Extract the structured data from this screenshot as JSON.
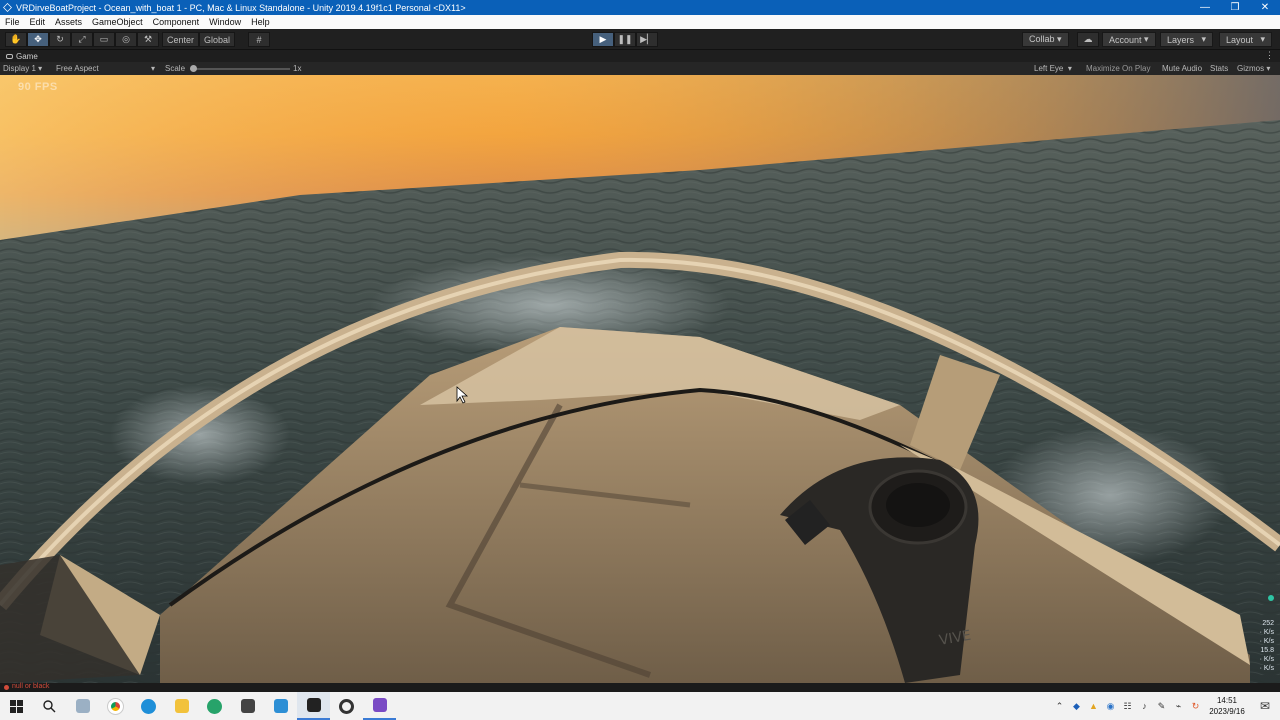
{
  "window": {
    "title": "VRDirveBoatProject - Ocean_with_boat 1 - PC, Mac & Linux Standalone - Unity 2019.4.19f1c1 Personal <DX11>",
    "controls": [
      "—",
      "❒",
      "✕"
    ]
  },
  "menu": [
    "File",
    "Edit",
    "Assets",
    "GameObject",
    "Component",
    "Window",
    "Help"
  ],
  "toolbar": {
    "tools": [
      "✋",
      "✥",
      "↻",
      "⤢",
      "▭",
      "◎",
      "⚒"
    ],
    "pivot_mode": "Center",
    "pivot_rotation": "Global",
    "grid_snap": "#",
    "play": "▶",
    "pause": "❚❚",
    "step": "▶▏",
    "collab": "Collab ▾",
    "cloud": "☁",
    "account": "Account",
    "layers": "Layers",
    "layout": "Layout",
    "dropdown_arrow": "▾"
  },
  "game_tab": {
    "label": "Game",
    "menu_dots": "⋮"
  },
  "game_bar": {
    "display": "Display 1",
    "aspect": "Free Aspect",
    "scale_label": "Scale",
    "scale_value": "1x",
    "eye": "Left Eye",
    "maximize": "Maximize On Play",
    "mute": "Mute Audio",
    "stats": "Stats",
    "gizmos": "Gizmos"
  },
  "viewport": {
    "fps": "90 FPS",
    "side_stats": [
      "252",
      "· K/s",
      "· K/s",
      "15.8",
      "· K/s",
      "· K/s"
    ],
    "controller_brand": "VIVE"
  },
  "status": {
    "message": "null or black"
  },
  "taskbar": {
    "apps": [
      "windows-start",
      "search",
      "task-view",
      "chrome",
      "edge",
      "file-explorer",
      "edge-dev",
      "unity-hub",
      "visual-studio-code",
      "unity",
      "steam-vr",
      "visual-studio"
    ],
    "tray_icons": [
      "⌃",
      "◆",
      "▲",
      "◉",
      "☷",
      "♪",
      "✎",
      "⌁",
      "↻"
    ],
    "time": "14:51",
    "date": "2023/9/16",
    "notifications": "✉"
  },
  "colors": {
    "title_bar": "#0a60b8",
    "play_active": "#46607c",
    "sunset_sky": "#f3a53c",
    "ocean": "#3d4a48",
    "boat_hull": "#c9b18e"
  }
}
